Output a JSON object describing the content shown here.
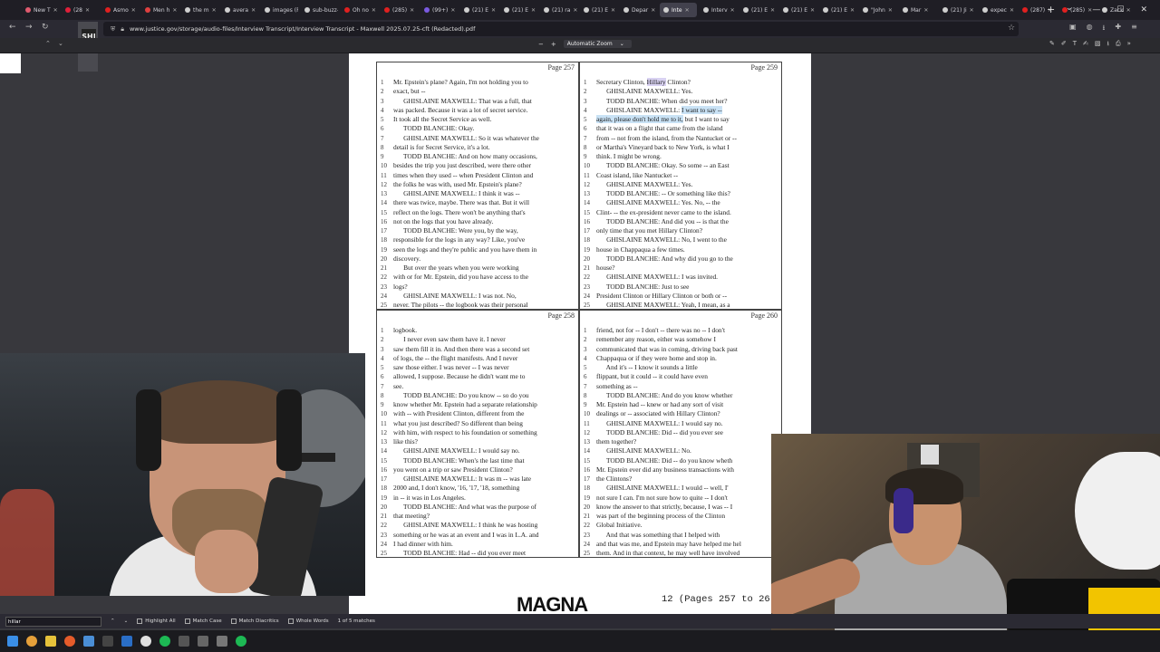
{
  "browser": {
    "tabs": [
      {
        "label": "New T",
        "color": "#e05a6e"
      },
      {
        "label": "(28",
        "color": "#e0203a"
      },
      {
        "label": "Asmo",
        "color": "#e02020"
      },
      {
        "label": "Men h",
        "color": "#e04040"
      },
      {
        "label": "the m",
        "color": "#cfcfcf"
      },
      {
        "label": "avera",
        "color": "#cfcfcf"
      },
      {
        "label": "images (F",
        "color": "#cfcfcf"
      },
      {
        "label": "sub-buzz-",
        "color": "#cfcfcf"
      },
      {
        "label": "Oh no",
        "color": "#e02020"
      },
      {
        "label": "(285)",
        "color": "#e02020"
      },
      {
        "label": "(99+)",
        "color": "#7a5ae0"
      },
      {
        "label": "(21) E",
        "color": "#cfcfcf"
      },
      {
        "label": "(21) E",
        "color": "#cfcfcf"
      },
      {
        "label": "(21) ra",
        "color": "#cfcfcf"
      },
      {
        "label": "(21) E",
        "color": "#cfcfcf"
      },
      {
        "label": "Depar",
        "color": "#cfcfcf"
      },
      {
        "label": "Inte",
        "color": "#cfcfcf",
        "active": true
      },
      {
        "label": "Interv",
        "color": "#cfcfcf"
      },
      {
        "label": "(21) E",
        "color": "#cfcfcf"
      },
      {
        "label": "(21) E",
        "color": "#cfcfcf"
      },
      {
        "label": "(21) E",
        "color": "#cfcfcf"
      },
      {
        "label": "\"John",
        "color": "#cfcfcf"
      },
      {
        "label": "Mar",
        "color": "#cfcfcf"
      },
      {
        "label": "(21) Ji",
        "color": "#cfcfcf"
      },
      {
        "label": "expec",
        "color": "#cfcfcf"
      },
      {
        "label": "(287)",
        "color": "#e02020"
      },
      {
        "label": "(285)",
        "color": "#e02020"
      },
      {
        "label": "Zack",
        "color": "#cfcfcf"
      }
    ],
    "url": "www.justice.gov/storage/audio-files/Interview Transcript/Interview Transcript - Maxwell 2025.07.25-cft (Redacted).pdf",
    "new_tab": "+",
    "tab_list": "⌄"
  },
  "pdf": {
    "zoom_label": "Automatic Zoom",
    "zoom_minus": "−",
    "zoom_plus": "+",
    "sidebar_badge": "SHI",
    "sidebar_badge_sub": "66",
    "pages": {
      "p257": {
        "num": "Page 257",
        "lines": [
          "Mr. Epstein's plane? Again, I'm not holding you to",
          "exact, but --",
          "      GHISLAINE MAXWELL: That was a full, that",
          "was packed. Because it was a lot of secret service.",
          "It took all the Secret Service as well.",
          "      TODD BLANCHE: Okay.",
          "      GHISLAINE MAXWELL: So it was whatever the",
          "detail is for Secret Service, it's a lot.",
          "      TODD BLANCHE: And on how many occasions,",
          "besides the trip you just described, were there other",
          "times when they used -- when President Clinton and",
          "the folks he was with, used Mr. Epstein's plane?",
          "      GHISLAINE MAXWELL: I think it was --",
          "there was twice, maybe. There was that. But it will",
          "reflect on the logs. There won't be anything that's",
          "not on the logs that you have already.",
          "      TODD BLANCHE: Were you, by the way,",
          "responsible for the logs in any way? Like, you've",
          "seen the logs and they're public and you have them in",
          "discovery.",
          "      But over the years when you were working",
          "with or for Mr. Epstein, did you have access to the",
          "logs?",
          "      GHISLAINE MAXWELL: I was not. No,",
          "never. The pilots -- the logbook was their personal"
        ]
      },
      "p258": {
        "num": "Page 258",
        "lines": [
          "logbook.",
          "      I never even saw them have it. I never",
          "saw them fill it in. And then there was a second set",
          "of logs, the -- the flight manifests. And I never",
          "saw those either. I was never -- I was never",
          "allowed, I suppose. Because he didn't want me to",
          "see.",
          "      TODD BLANCHE: Do you know -- so do you",
          "know whether Mr. Epstein had a separate relationship",
          "with -- with President Clinton, different from the",
          "what you just described? So different than being",
          "with him, with respect to his foundation or something",
          "like this?",
          "      GHISLAINE MAXWELL: I would say no.",
          "      TODD BLANCHE: When's the last time that",
          "you went on a trip or saw President Clinton?",
          "      GHISLAINE MAXWELL: It was m -- was late",
          "2000 and, I don't know, '16, '17, '18, something",
          "in -- it was in Los Angeles.",
          "      TODD BLANCHE: And what was the purpose of",
          "that meeting?",
          "      GHISLAINE MAXWELL: I think he was hosting",
          "something or he was at an event and I was in L.A. and",
          "I had dinner with him.",
          "      TODD BLANCHE: Had -- did you ever meet"
        ]
      },
      "p259": {
        "num": "Page 259",
        "lines": [
          "Secretary Clinton, Hillary Clinton?",
          "      GHISLAINE MAXWELL: Yes.",
          "      TODD BLANCHE: When did you meet her?",
          "      GHISLAINE MAXWELL: I want to say --",
          "again, please don't hold me to it, but I want to say",
          "that it was on a flight that came from the island",
          "from -- not from the island, from the Nantucket or --",
          "or Martha's Vineyard back to New York, is what I",
          "think. I might be wrong.",
          "      TODD BLANCHE: Okay. So some -- an East",
          "Coast island, like Nantucket --",
          "      GHISLAINE MAXWELL: Yes.",
          "      TODD BLANCHE: -- Or something like this?",
          "      GHISLAINE MAXWELL: Yes. No, -- the",
          "Clint- -- the ex-president never came to the island.",
          "      TODD BLANCHE: And did you -- is that the",
          "only time that you met Hillary Clinton?",
          "      GHISLAINE MAXWELL: No, I went to the",
          "house in Chappaqua a few times.",
          "      TODD BLANCHE: And why did you go to the",
          "house?",
          "      GHISLAINE MAXWELL: I was invited.",
          "      TODD BLANCHE: Just to see",
          "President Clinton or Hillary Clinton or both or --",
          "      GHISLAINE MAXWELL: Yeah, I mean, as a"
        ]
      },
      "p260": {
        "num": "Page 260",
        "lines": [
          "friend, not for -- I don't -- there was no -- I don't",
          "remember any reason, either was somehow I",
          "communicated that was in coming, driving back past",
          "Chappaqua or if they were home and stop in.",
          "      And it's -- I know it sounds a little",
          "flippant, but it could -- it could have even",
          "something as --",
          "      TODD BLANCHE: And do you know whether",
          "Mr. Epstein had -- knew or had any sort of visit",
          "dealings or -- associated with Hillary Clinton?",
          "      GHISLAINE MAXWELL: I would say no.",
          "      TODD BLANCHE: Did -- did you ever see",
          "them together?",
          "      GHISLAINE MAXWELL: No.",
          "      TODD BLANCHE: Did -- do you know wheth",
          "Mr. Epstein ever did any business transactions with",
          "the Clintons?",
          "      GHISLAINE MAXWELL: I would -- well, I'",
          "not sure I can. I'm not sure how to quite -- I don't",
          "know the answer to that strictly, because, I was -- I",
          "was part of the beginning process of the Clinton",
          "Global Initiative.",
          "      And that was something that I helped with",
          "and that was me, and Epstein may have helped me hel",
          "them. And in that context, he may well have involved"
        ]
      }
    },
    "footer_logo": "MAGNA",
    "footer_pages": "12 (Pages 257 to 26"
  },
  "findbar": {
    "query": "hillar",
    "highlight_all": "Highlight All",
    "match_case": "Match Case",
    "match_diacritics": "Match Diacritics",
    "whole_words": "Whole Words",
    "matches": "1 of 5 matches"
  }
}
